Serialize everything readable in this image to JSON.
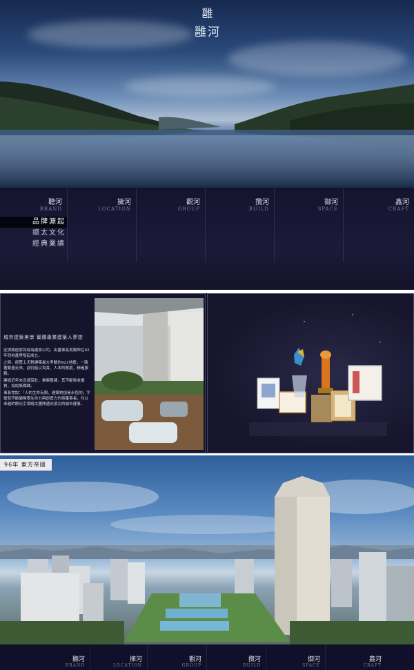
{
  "logo": {
    "mark": "雝",
    "name": "雝河"
  },
  "nav": [
    {
      "zh": "聽河",
      "en": "BRAND"
    },
    {
      "zh": "擁河",
      "en": "LOCATION"
    },
    {
      "zh": "觀河",
      "en": "GROUP"
    },
    {
      "zh": "攬河",
      "en": "BUILD"
    },
    {
      "zh": "御河",
      "en": "SPACE"
    },
    {
      "zh": "鑫河",
      "en": "CRAFT"
    }
  ],
  "submenu": [
    {
      "label": "品牌源起",
      "active": true
    },
    {
      "label": "總太文化",
      "active": false
    },
    {
      "label": "經典業績",
      "active": false
    }
  ],
  "brand_panel": {
    "headline": "城市建築美學  實踐專業建築人夢想",
    "paragraphs": [
      "定調築居家到成為建設公司，由董事長吳錫坤在92年同地產界發起成立。",
      "之時，經歷上天對建築最大考驗的921地震，一路著繁盛走來，卻仍能以負責、人本的態度，精確服務。",
      "建設近年來迅速茁壯，推案養捷，其不斷吸收優質，為說無職肆。",
      "事長常說：「人的生命有限，建築物卻是永恆的」字衝就不斷續無限生命力與創造力的吳董事長，均以卓越的眼光引領總太團隊邁向頂尖的城市建事。"
    ]
  },
  "project": {
    "tag": "96年  東方帝國"
  },
  "footer_nav": [
    {
      "zh": "聽河",
      "en": "BRAND"
    },
    {
      "zh": "擁河",
      "en": "LOCATION"
    },
    {
      "zh": "觀河",
      "en": "GROUP"
    },
    {
      "zh": "攬河",
      "en": "BUILD"
    },
    {
      "zh": "御河",
      "en": "SPACE"
    },
    {
      "zh": "鑫河",
      "en": "CRAFT"
    }
  ]
}
